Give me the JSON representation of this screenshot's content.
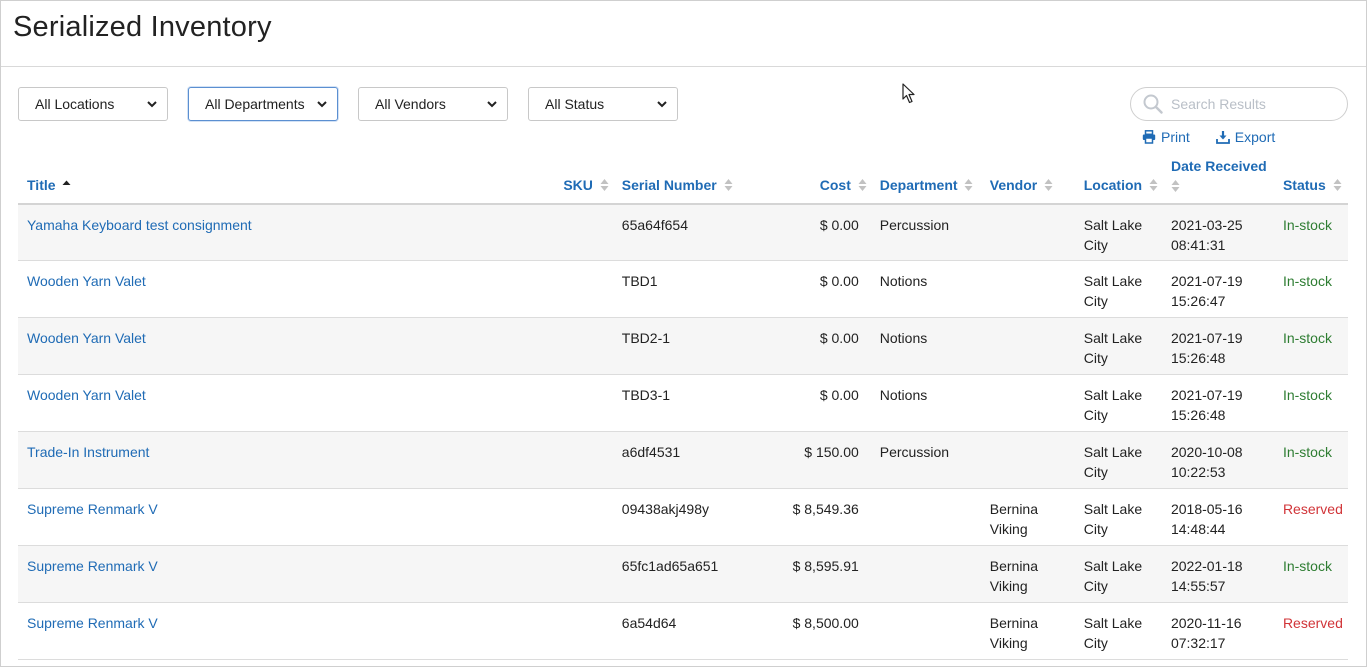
{
  "page": {
    "title": "Serialized Inventory"
  },
  "filters": {
    "locations": "All Locations",
    "departments": "All Departments",
    "vendors": "All Vendors",
    "status": "All Status"
  },
  "search": {
    "placeholder": "Search Results",
    "value": ""
  },
  "actions": {
    "print": "Print",
    "export": "Export"
  },
  "table": {
    "columns": {
      "title": "Title",
      "sku": "SKU",
      "serial": "Serial Number",
      "cost": "Cost",
      "department": "Department",
      "vendor": "Vendor",
      "location": "Location",
      "date": "Date Received",
      "status": "Status"
    },
    "sort": {
      "column": "title",
      "direction": "ascending"
    },
    "rows": [
      {
        "title": "Yamaha Keyboard test consignment",
        "sku": "",
        "serial": "65a64f654",
        "cost": "$ 0.00",
        "department": "Percussion",
        "vendor": "",
        "location": "Salt Lake City",
        "date": "2021-03-25 08:41:31",
        "status": "In-stock"
      },
      {
        "title": "Wooden Yarn Valet",
        "sku": "",
        "serial": "TBD1",
        "cost": "$ 0.00",
        "department": "Notions",
        "vendor": "",
        "location": "Salt Lake City",
        "date": "2021-07-19 15:26:47",
        "status": "In-stock"
      },
      {
        "title": "Wooden Yarn Valet",
        "sku": "",
        "serial": "TBD2-1",
        "cost": "$ 0.00",
        "department": "Notions",
        "vendor": "",
        "location": "Salt Lake City",
        "date": "2021-07-19 15:26:48",
        "status": "In-stock"
      },
      {
        "title": "Wooden Yarn Valet",
        "sku": "",
        "serial": "TBD3-1",
        "cost": "$ 0.00",
        "department": "Notions",
        "vendor": "",
        "location": "Salt Lake City",
        "date": "2021-07-19 15:26:48",
        "status": "In-stock"
      },
      {
        "title": "Trade-In Instrument",
        "sku": "",
        "serial": "a6df4531",
        "cost": "$ 150.00",
        "department": "Percussion",
        "vendor": "",
        "location": "Salt Lake City",
        "date": "2020-10-08 10:22:53",
        "status": "In-stock"
      },
      {
        "title": "Supreme Renmark V",
        "sku": "",
        "serial": "09438akj498y",
        "cost": "$ 8,549.36",
        "department": "",
        "vendor": "Bernina Viking",
        "location": "Salt Lake City",
        "date": "2018-05-16 14:48:44",
        "status": "Reserved"
      },
      {
        "title": "Supreme Renmark V",
        "sku": "",
        "serial": "65fc1ad65a651",
        "cost": "$ 8,595.91",
        "department": "",
        "vendor": "Bernina Viking",
        "location": "Salt Lake City",
        "date": "2022-01-18 14:55:57",
        "status": "In-stock"
      },
      {
        "title": "Supreme Renmark V",
        "sku": "",
        "serial": "6a54d64",
        "cost": "$ 8,500.00",
        "department": "",
        "vendor": "Bernina Viking",
        "location": "Salt Lake City",
        "date": "2020-11-16 07:32:17",
        "status": "Reserved"
      }
    ]
  },
  "colors": {
    "link": "#1f6bb5",
    "in_stock": "#2e7d32",
    "reserved": "#d13438",
    "sort_inactive": "#c2c2c2"
  }
}
